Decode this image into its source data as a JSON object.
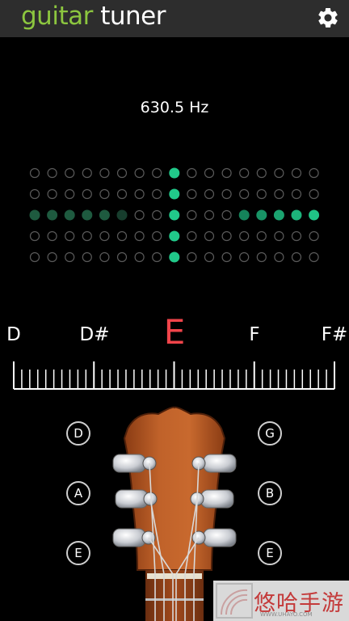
{
  "app": {
    "title_word_1": "guitar",
    "title_word_2": "tuner",
    "settings_icon": "gear-icon",
    "accent_color": "#8cc63f"
  },
  "tuner": {
    "frequency_text": "630.5 Hz",
    "current_note": "E",
    "current_note_color": "#f0444a",
    "dot_color": "#21c98a",
    "neighbor_notes": [
      "D",
      "D#",
      "E",
      "F",
      "F#"
    ]
  },
  "strings": {
    "left": [
      "D",
      "A",
      "E"
    ],
    "right": [
      "G",
      "B",
      "E"
    ]
  },
  "watermark": {
    "text": "悠哈手游",
    "sub_text": "WWW.UHAYO.COM"
  }
}
